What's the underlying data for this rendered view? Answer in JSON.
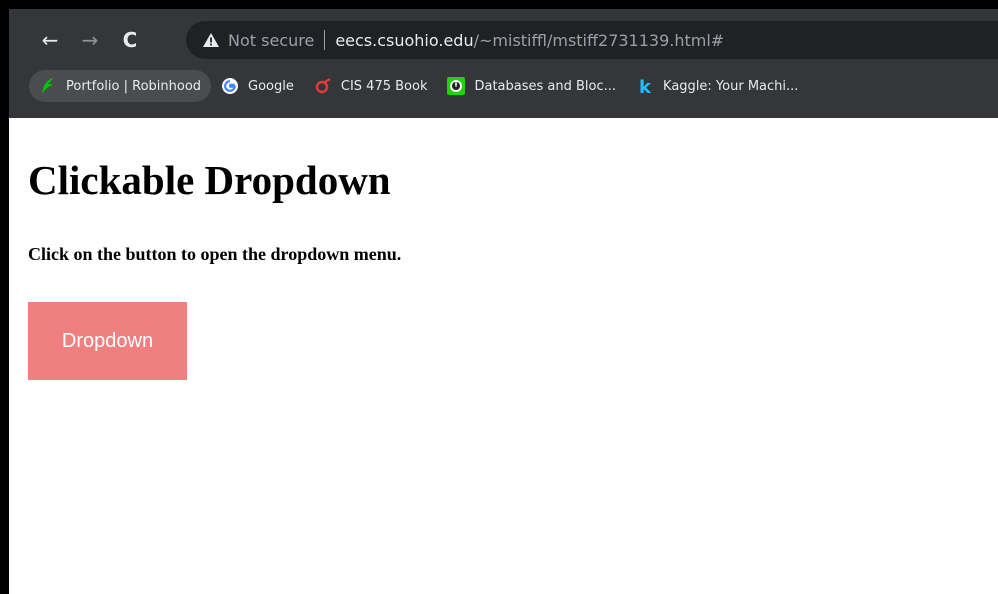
{
  "browser": {
    "nav": {
      "back_glyph": "←",
      "forward_glyph": "→",
      "reload_glyph": "C"
    },
    "omnibox": {
      "security_text": "Not secure",
      "url_host": "eecs.csuohio.edu",
      "url_path": "/~mistiffl/mstiff2731139.html#"
    },
    "bookmarks": [
      {
        "label": "Portfolio | Robinhood",
        "icon": "robinhood-feather-icon",
        "color": "#00c805"
      },
      {
        "label": "Google",
        "icon": "google-icon",
        "color": "#4285f4"
      },
      {
        "label": "CIS 475 Book",
        "icon": "book-logo-icon",
        "color": "#e53935"
      },
      {
        "label": "Databases and Bloc...",
        "icon": "database-clock-icon",
        "color": "#1bd600"
      },
      {
        "label": "Kaggle: Your Machi...",
        "icon": "kaggle-icon",
        "color": "#20beff"
      }
    ]
  },
  "page": {
    "title": "Clickable Dropdown",
    "subtitle": "Click on the button to open the dropdown menu.",
    "dropdown_label": "Dropdown",
    "button_color": "#f08080"
  }
}
